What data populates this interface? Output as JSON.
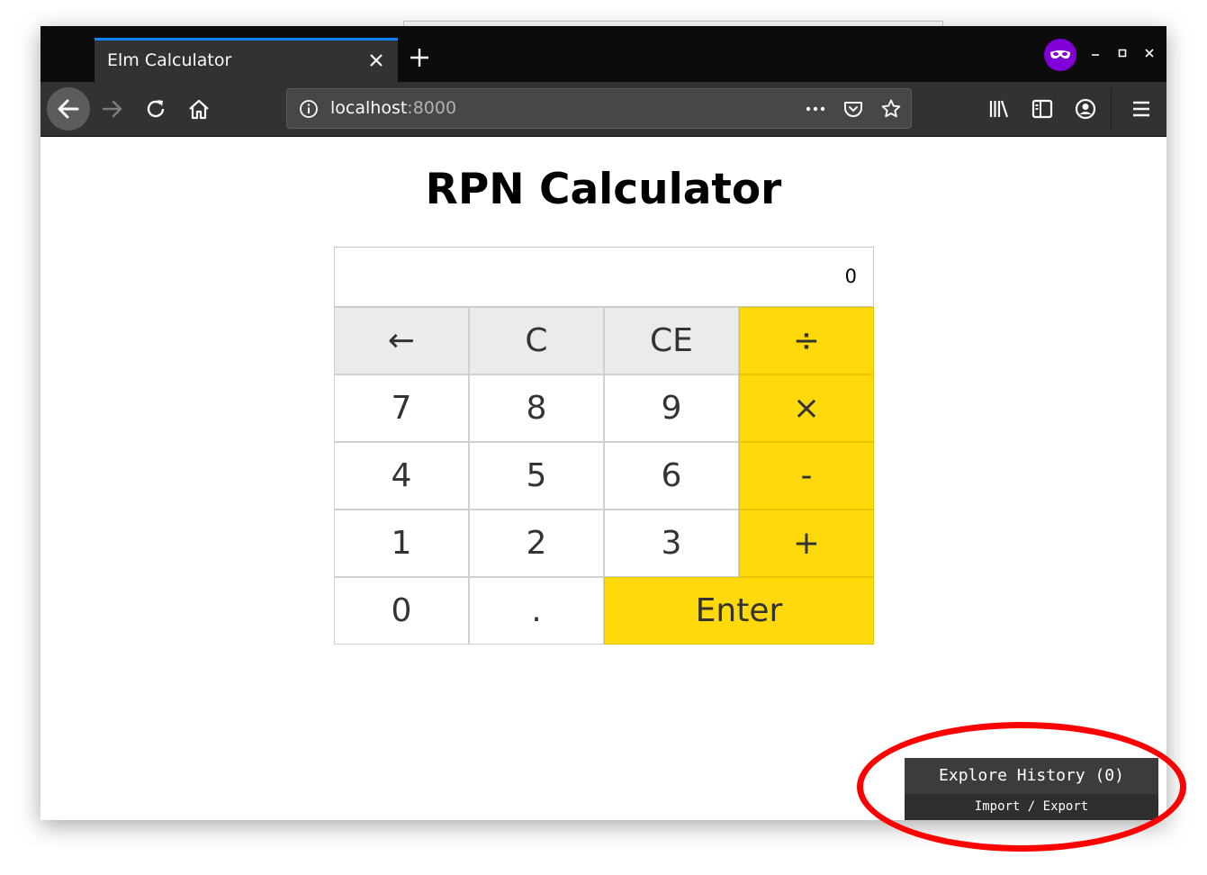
{
  "browser": {
    "tab_title": "Elm Calculator",
    "url_host": "localhost",
    "url_port": ":8000"
  },
  "page": {
    "title": "RPN Calculator",
    "display_value": "0",
    "keys": {
      "backspace": "←",
      "clear": "C",
      "clear_entry": "CE",
      "divide": "÷",
      "seven": "7",
      "eight": "8",
      "nine": "9",
      "multiply": "×",
      "four": "4",
      "five": "5",
      "six": "6",
      "subtract": "-",
      "one": "1",
      "two": "2",
      "three": "3",
      "add": "+",
      "zero": "0",
      "decimal": ".",
      "enter": "Enter"
    }
  },
  "debugger": {
    "explore_label": "Explore History (0)",
    "import_export_label": "Import / Export"
  },
  "colors": {
    "operator_key": "#ffd90a",
    "function_key": "#ebebeb",
    "tab_accent": "#0a84ff",
    "private_badge": "#8000d7",
    "annotation_ring": "#ff0000"
  }
}
